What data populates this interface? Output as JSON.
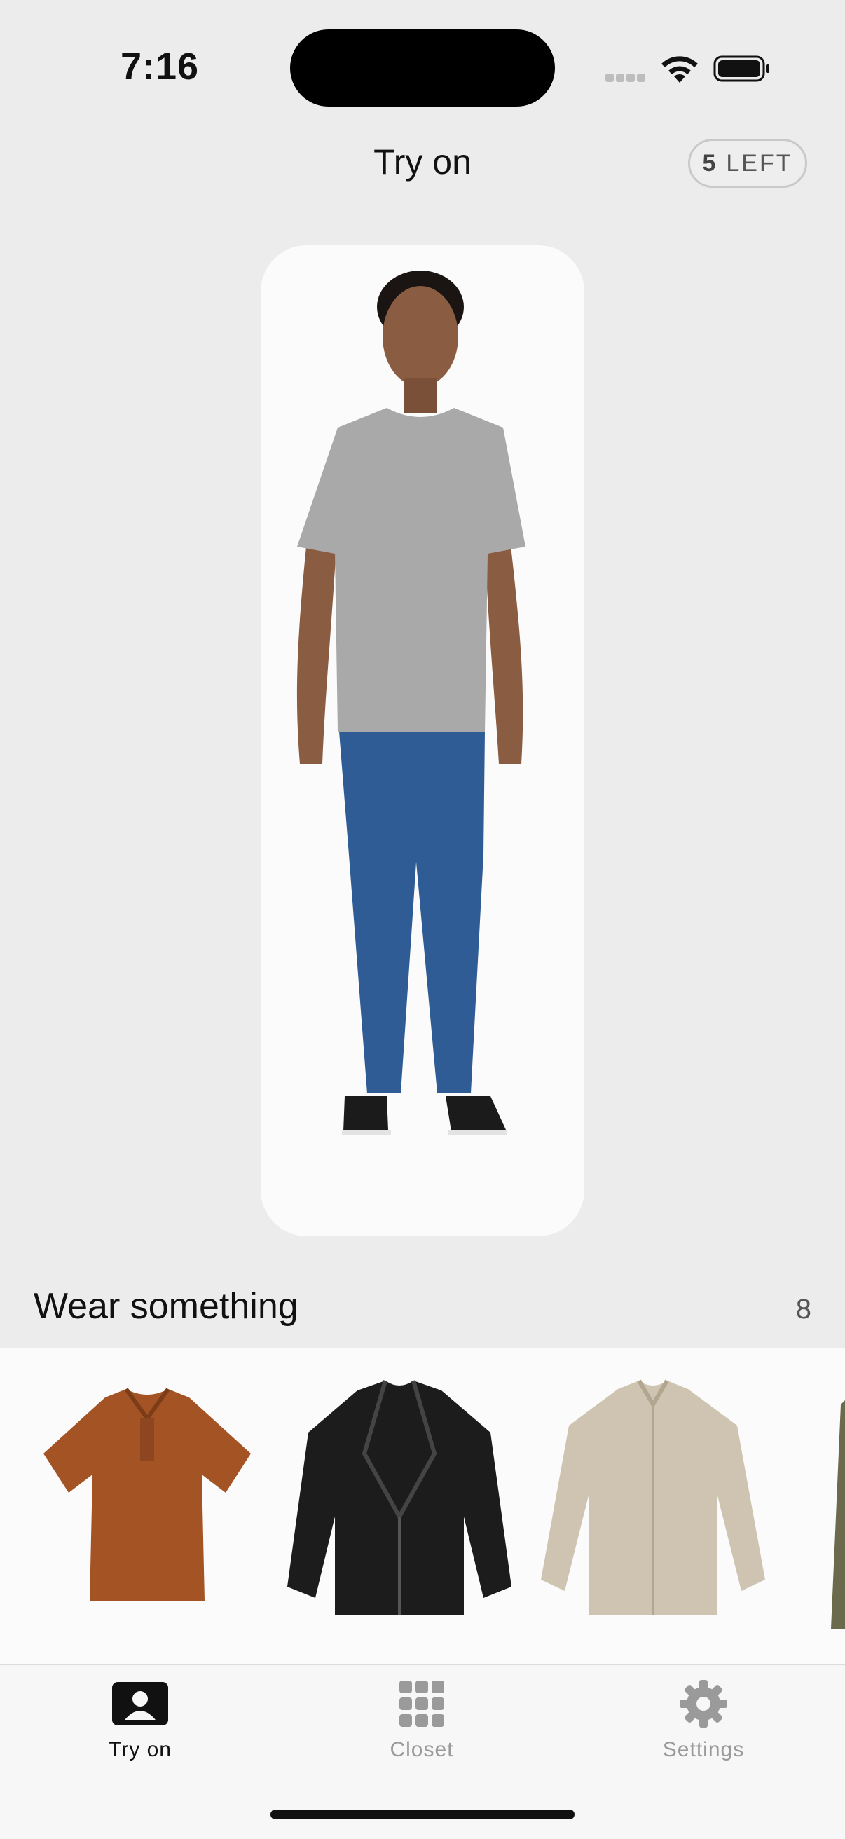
{
  "status": {
    "time": "7:16"
  },
  "header": {
    "title": "Try on",
    "left_count": "5",
    "left_label": "LEFT"
  },
  "model": {
    "label": "model-photo"
  },
  "wardrobe": {
    "title": "Wear something",
    "count": "8",
    "items": [
      {
        "name": "rust polo shirt",
        "color": "#a45424"
      },
      {
        "name": "black leather jacket",
        "color": "#1c1c1c"
      },
      {
        "name": "beige linen shirt",
        "color": "#cfc4b2"
      },
      {
        "name": "olive item (partially visible)",
        "color": "#6b6a4c"
      }
    ]
  },
  "tabs": [
    {
      "label": "Try on",
      "icon": "person-icon",
      "active": true
    },
    {
      "label": "Closet",
      "icon": "grid-icon",
      "active": false
    },
    {
      "label": "Settings",
      "icon": "gear-icon",
      "active": false
    }
  ]
}
